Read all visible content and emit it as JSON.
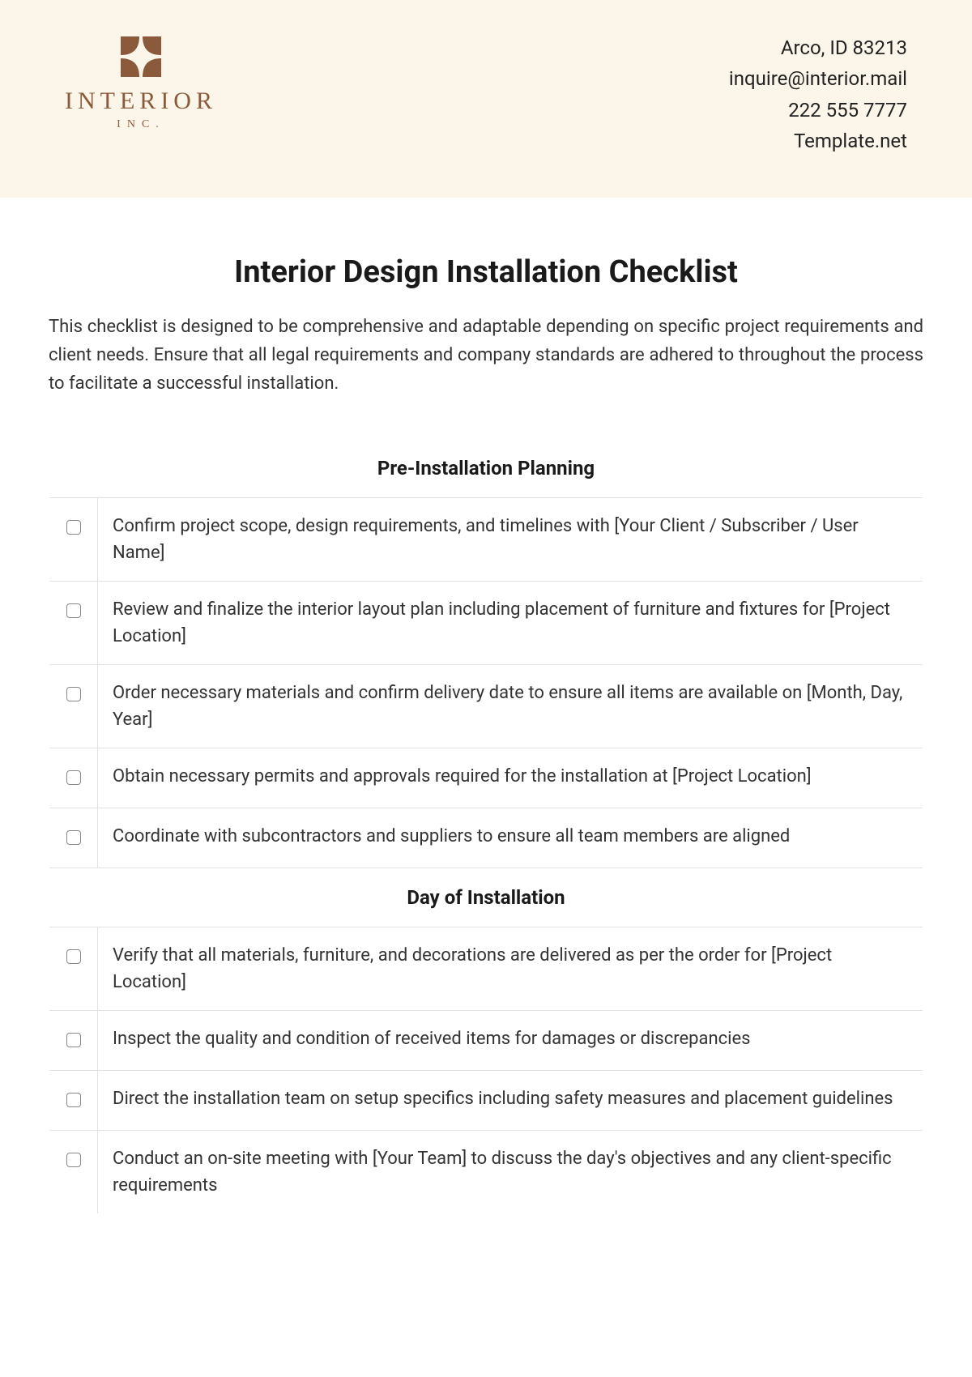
{
  "header": {
    "logo": {
      "name": "INTERIOR",
      "sub": "INC."
    },
    "contact": {
      "address": "Arco, ID 83213",
      "email": "inquire@interior.mail",
      "phone": "222 555 7777",
      "site": "Template.net"
    }
  },
  "document": {
    "title": "Interior Design Installation Checklist",
    "intro": "This checklist is designed to be comprehensive and adaptable depending on specific project requirements and client needs. Ensure that all legal requirements and company standards are adhered to throughout the process to facilitate a successful installation."
  },
  "sections": [
    {
      "heading": "Pre-Installation Planning",
      "items": [
        "Confirm project scope, design requirements, and timelines with [Your Client / Subscriber / User Name]",
        "Review and finalize the interior layout plan including placement of furniture and fixtures for [Project Location]",
        "Order necessary materials and confirm delivery date to ensure all items are available on [Month, Day, Year]",
        "Obtain necessary permits and approvals required for the installation at [Project Location]",
        "Coordinate with subcontractors and suppliers to ensure all team members are aligned"
      ]
    },
    {
      "heading": "Day of Installation",
      "items": [
        "Verify that all materials, furniture, and decorations are delivered as per the order for [Project Location]",
        "Inspect the quality and condition of received items for damages or discrepancies",
        "Direct the installation team on setup specifics including safety measures and placement guidelines",
        "Conduct an on-site meeting with [Your Team] to discuss the day's objectives and any client-specific requirements"
      ]
    }
  ]
}
